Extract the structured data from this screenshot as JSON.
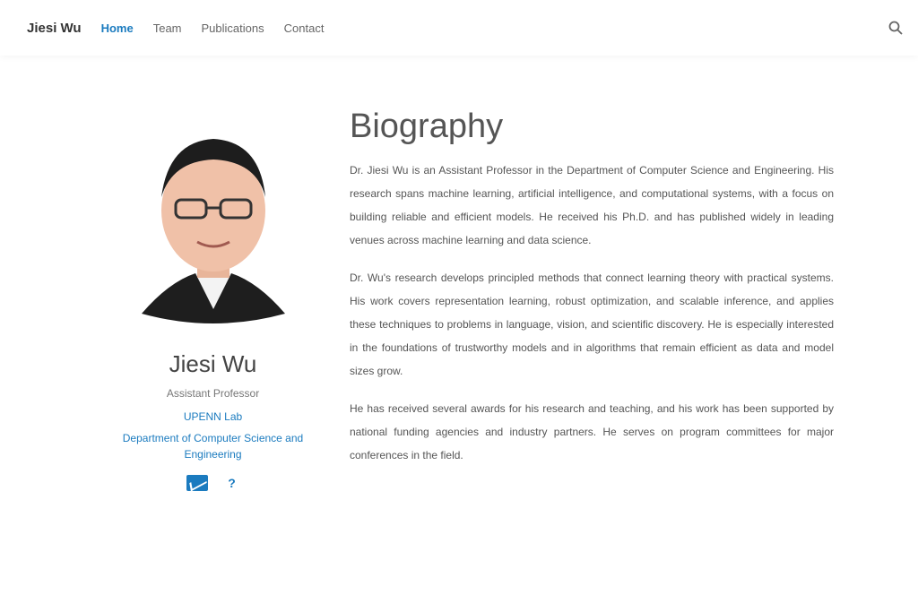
{
  "nav": {
    "brand": "Jiesi Wu",
    "links": [
      "Home",
      "Team",
      "Publications",
      "Contact"
    ],
    "active_index": 0
  },
  "profile": {
    "name": "Jiesi Wu",
    "role": "Assistant Professor",
    "affiliation_short": "UPENN Lab",
    "affiliation_long": "Department of Computer Science and Engineering"
  },
  "biography": {
    "title": "Biography",
    "paragraphs": [
      "Dr. Jiesi Wu is an Assistant Professor in the Department of Computer Science and Engineering. His research spans machine learning, artificial intelligence, and computational systems, with a focus on building reliable and efficient models. He received his Ph.D. and has published widely in leading venues across machine learning and data science.",
      "Dr. Wu's research develops principled methods that connect learning theory with practical systems. His work covers representation learning, robust optimization, and scalable inference, and applies these techniques to problems in language, vision, and scientific discovery. He is especially interested in the foundations of trustworthy models and in algorithms that remain efficient as data and model sizes grow.",
      "He has received several awards for his research and teaching, and his work has been supported by national funding agencies and industry partners. He serves on program committees for major conferences in the field."
    ]
  },
  "colors": {
    "accent": "#1b7bbf",
    "text": "#555555",
    "background": "#ffffff"
  },
  "icons": [
    "search-icon",
    "mail-icon",
    "scholar-icon"
  ]
}
